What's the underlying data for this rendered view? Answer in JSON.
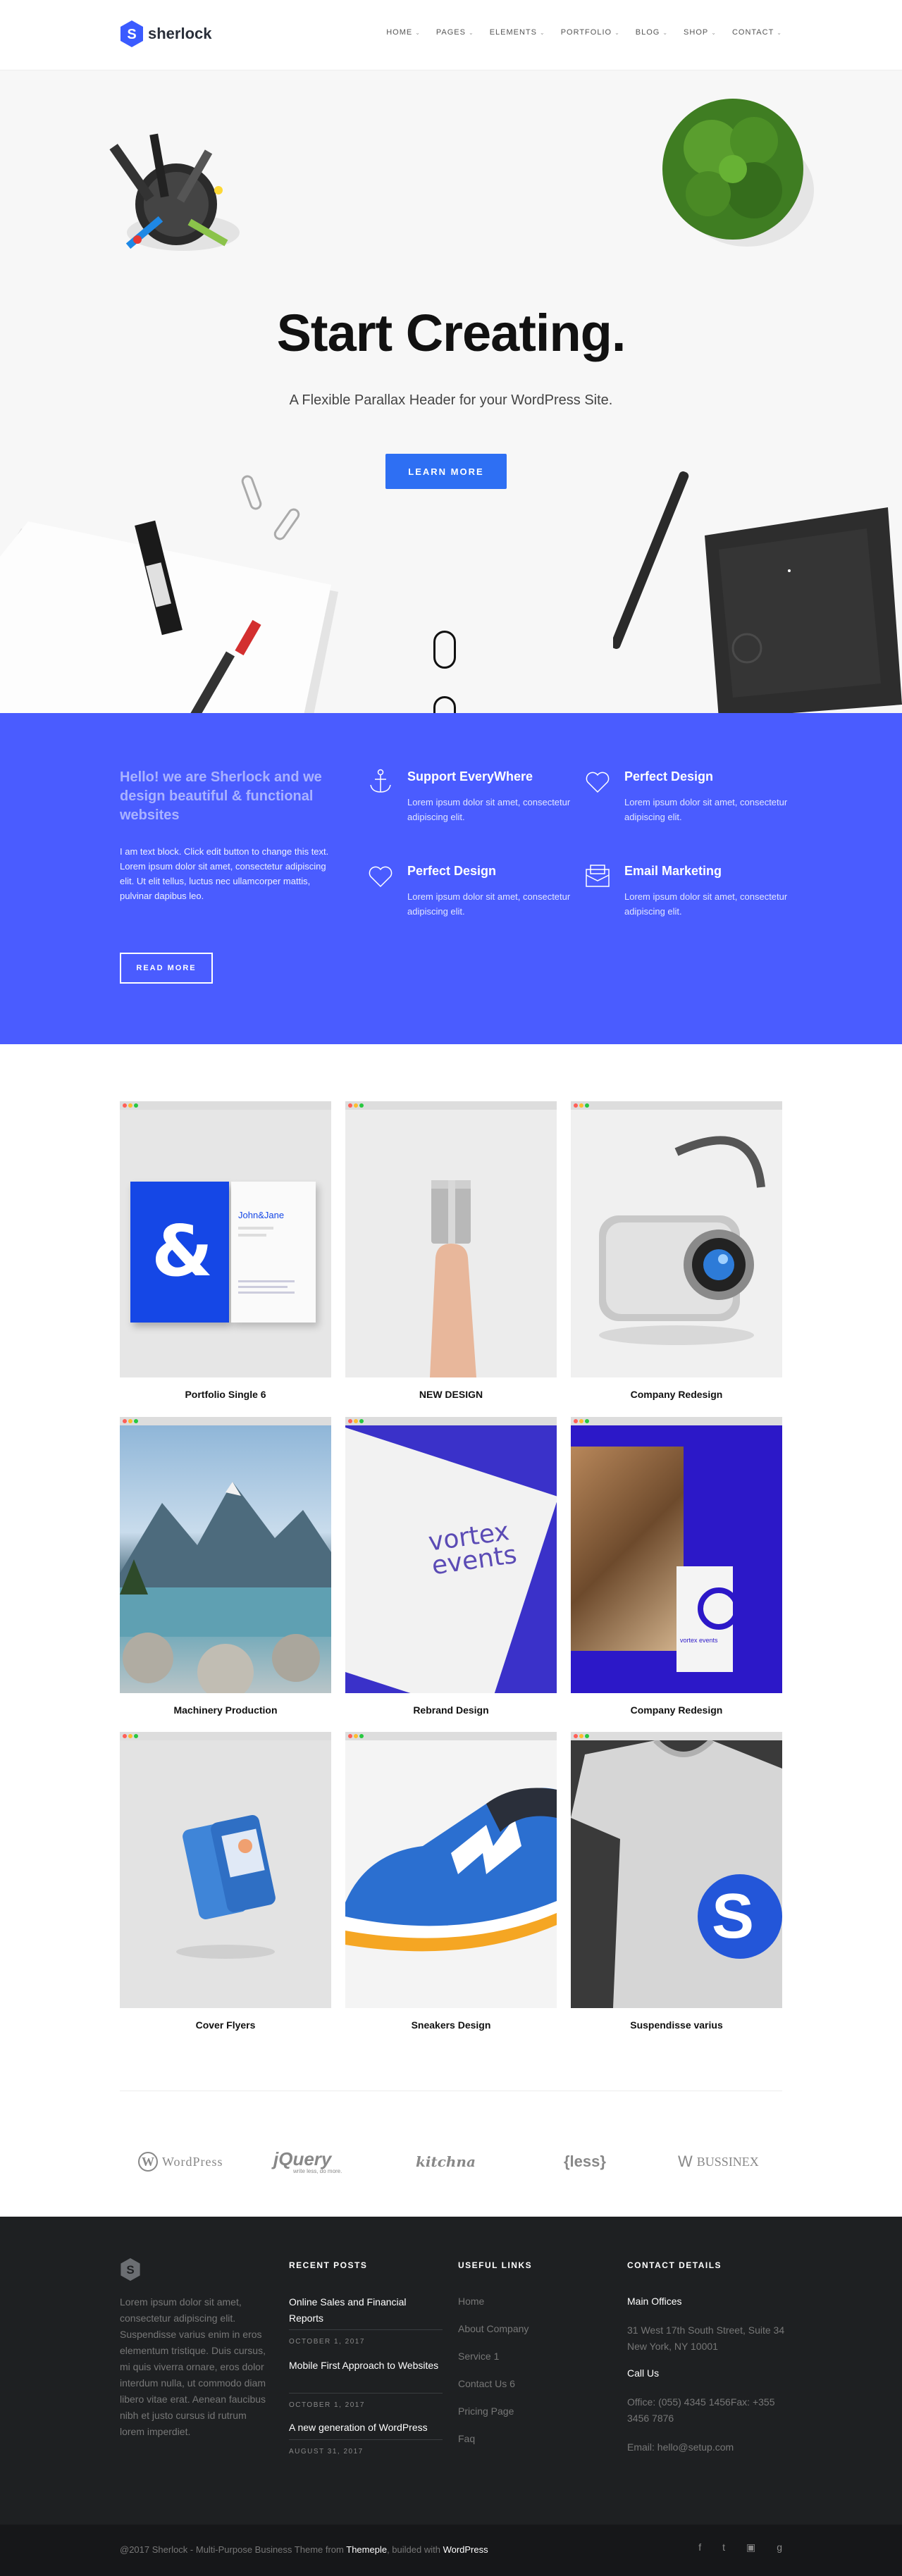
{
  "brand": {
    "name": "sherlock"
  },
  "nav": [
    {
      "label": "HOME"
    },
    {
      "label": "PAGES"
    },
    {
      "label": "ELEMENTS"
    },
    {
      "label": "PORTFOLIO"
    },
    {
      "label": "BLOG"
    },
    {
      "label": "SHOP"
    },
    {
      "label": "CONTACT"
    }
  ],
  "hero": {
    "title": "Start Creating.",
    "subtitle": "A Flexible Parallax Header for your WordPress Site.",
    "button": "LEARN MORE"
  },
  "features": {
    "heading": "Hello! we are Sherlock and we design beautiful & functional websites",
    "body": "I am text block. Click edit button to change this text. Lorem ipsum dolor sit amet, consectetur adipiscing elit. Ut elit tellus, luctus nec ullamcorper mattis, pulvinar dapibus leo.",
    "button": "READ MORE",
    "items": [
      {
        "title": "Support EveryWhere",
        "text": "Lorem ipsum dolor sit amet, consectetur adipiscing elit.",
        "icon": "anchor-icon"
      },
      {
        "title": "Perfect Design",
        "text": "Lorem ipsum dolor sit amet, consectetur adipiscing elit.",
        "icon": "heart-icon"
      },
      {
        "title": "Perfect Design",
        "text": "Lorem ipsum dolor sit amet, consectetur adipiscing elit.",
        "icon": "heart-icon"
      },
      {
        "title": "Email Marketing",
        "text": "Lorem ipsum dolor sit amet, consectetur adipiscing elit.",
        "icon": "envelope-icon"
      }
    ]
  },
  "portfolio": [
    {
      "title": "Portfolio Single 6"
    },
    {
      "title": "NEW DESIGN"
    },
    {
      "title": "Company Redesign"
    },
    {
      "title": "Machinery Production"
    },
    {
      "title": "Rebrand Design"
    },
    {
      "title": "Company Redesign"
    },
    {
      "title": "Cover Flyers"
    },
    {
      "title": "Sneakers Design"
    },
    {
      "title": "Suspendisse varius"
    }
  ],
  "portfolio_art": {
    "card1_logo": "&",
    "card1_name": "John&Jane",
    "card5_text": "vortex events",
    "card6_text": "vortex events"
  },
  "clients": [
    "WordPress",
    "jQuery",
    "kitchna",
    "{less}",
    "BUSSINEX"
  ],
  "clients_sub": {
    "jquery_tag": "write less, do more."
  },
  "footer": {
    "about": "Lorem ipsum dolor sit amet, consectetur adipiscing elit. Suspendisse varius enim in eros elementum tristique. Duis cursus, mi quis viverra ornare, eros dolor interdum nulla, ut commodo diam libero vitae erat. Aenean faucibus nibh et justo cursus id rutrum lorem imperdiet.",
    "recent_title": "RECENT POSTS",
    "posts": [
      {
        "title": "Online Sales and Financial Reports",
        "date": "OCTOBER 1, 2017"
      },
      {
        "title": "Mobile First Approach to Websites",
        "date": "OCTOBER 1, 2017"
      },
      {
        "title": "A new generation of WordPress",
        "date": "AUGUST 31, 2017"
      }
    ],
    "links_title": "USEFUL LINKS",
    "links": [
      "Home",
      "About Company",
      "Service 1",
      "Contact Us 6",
      "Pricing Page",
      "Faq"
    ],
    "contact_title": "CONTACT DETAILS",
    "main_office_label": "Main Offices",
    "address": "31 West 17th South Street, Suite 34 New York, NY 10001",
    "call_label": "Call Us",
    "phones": "Office: (055) 4345 1456Fax: +355 3456 7876",
    "email": "Email: hello@setup.com"
  },
  "bottom": {
    "copy_prefix": "@2017 Sherlock - Multi-Purpose Business Theme from ",
    "copy_brand": "Themeple",
    "copy_mid": ", builded with ",
    "copy_wp": "WordPress"
  },
  "socials": [
    "f",
    "t",
    "▣",
    "g"
  ],
  "colors": {
    "accent": "#2e6ff3",
    "band": "#4a5cff",
    "footer": "#1e2022"
  }
}
